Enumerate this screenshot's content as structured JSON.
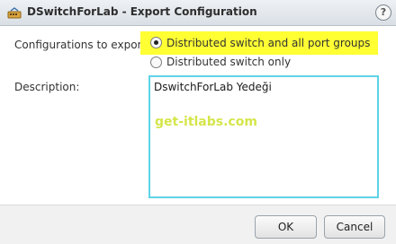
{
  "window": {
    "title": "DSwitchForLab - Export Configuration",
    "help_label": "?",
    "title_icon": "distributed-switch-icon"
  },
  "form": {
    "configs_label": "Configurations to export:",
    "options": [
      {
        "label": "Distributed switch and all port groups",
        "selected": true
      },
      {
        "label": "Distributed switch only",
        "selected": false
      }
    ],
    "highlight_color": "#ffff33",
    "description_label": "Description:",
    "description_value": "DswitchForLab Yedeği"
  },
  "watermark": "get-itlabs.com",
  "buttons": {
    "ok": "OK",
    "cancel": "Cancel"
  }
}
